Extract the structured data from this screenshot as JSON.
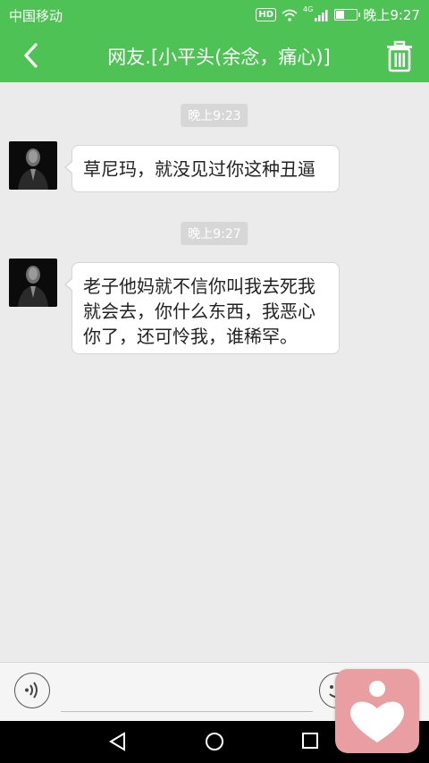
{
  "status_bar": {
    "carrier": "中国移动",
    "hd_badge": "HD",
    "network": "4G",
    "time": "晚上9:27"
  },
  "header": {
    "title": "网友.[小平头(余念，痛心)]"
  },
  "messages": [
    {
      "time": "晚上9:23",
      "text": "草尼玛，就没见过你这种丑逼"
    },
    {
      "time": "晚上9:27",
      "text": "老子他妈就不信你叫我去死我就会去，你什么东西，我恶心你了，还可怜我，谁稀罕。"
    }
  ],
  "input": {
    "value": "",
    "placeholder": ""
  },
  "colors": {
    "accent": "#4ec254",
    "chat_background": "#ebebeb",
    "bubble": "#ffffff",
    "time_badge": "#d7d7d7",
    "float_widget": "#e99ea2"
  },
  "icons": {
    "back": "chevron-left-icon",
    "delete": "trash-icon",
    "voice": "voice-icon",
    "emoji": "emoji-icon",
    "float": "heart-person-icon"
  }
}
